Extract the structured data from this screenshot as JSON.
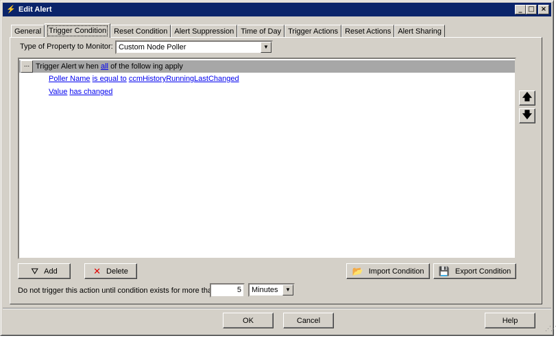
{
  "window": {
    "title": "Edit Alert",
    "buttons": {
      "minimize": "_",
      "maximize": "□",
      "close": "×"
    }
  },
  "tabs": [
    {
      "label": "General"
    },
    {
      "label": "Trigger Condition",
      "active": true
    },
    {
      "label": "Reset Condition"
    },
    {
      "label": "Alert Suppression"
    },
    {
      "label": "Time of Day"
    },
    {
      "label": "Trigger Actions"
    },
    {
      "label": "Reset Actions"
    },
    {
      "label": "Alert Sharing"
    }
  ],
  "property": {
    "label": "Type of Property to Monitor:",
    "value": "Custom Node Poller"
  },
  "conditions": {
    "header_btn": "...",
    "header_prefix": "Trigger Alert w hen",
    "header_link": "all",
    "header_suffix": "of the follow ing apply",
    "rows": [
      {
        "field": "Poller Name",
        "operator": "is equal to",
        "value": "ccmHistoryRunningLastChanged"
      },
      {
        "field": "Value",
        "operator": "has changed"
      }
    ]
  },
  "move_buttons": {
    "up": "🡅",
    "down": "🡇"
  },
  "actions": {
    "add": "Add",
    "delete": "Delete",
    "import": "Import Condition",
    "export": "Export Condition"
  },
  "delay": {
    "label": "Do not trigger this action until condition exists for more than",
    "value": "5",
    "unit": "Minutes"
  },
  "dialog": {
    "ok": "OK",
    "cancel": "Cancel",
    "help": "Help"
  },
  "colors": {
    "titlebar": "#0a246a",
    "face": "#d4d0c8",
    "link": "#0000ee",
    "delete_icon": "#e00000"
  }
}
